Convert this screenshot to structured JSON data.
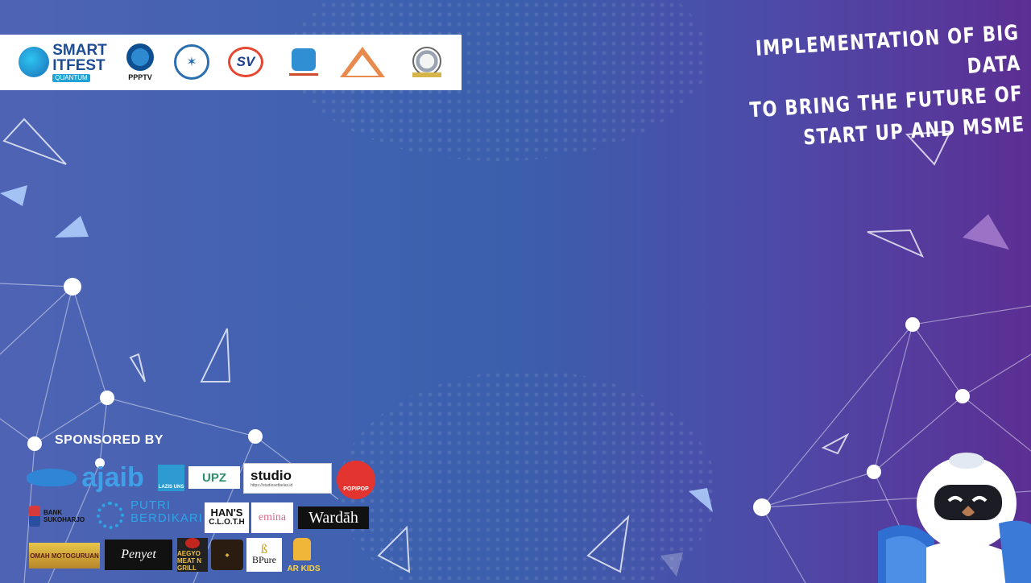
{
  "headline": {
    "line1": "IMPLEMENTATION OF BIG DATA",
    "line2": "TO BRING THE FUTURE OF",
    "line3": "START UP AND MSME"
  },
  "logo_bar": {
    "smart_line1": "SMART",
    "smart_line2": "ITFEST",
    "smart_tag": "QUANTUM",
    "ppptv_label": "PPPTV"
  },
  "sponsored": {
    "heading": "SPONSORED BY",
    "ajaib": "ajaib",
    "lazis": "LAZIS UNS",
    "upz": "UPZ",
    "studio_name": "studio",
    "studio_tag": "https://studiosetbelas.id",
    "popipop": "POPIPOP",
    "bank_line1": "BANK",
    "bank_line2": "SUKOHARJO",
    "putri_line1": "PUTRI",
    "putri_line2": "BERDIKARI",
    "hans_line1": "HAN'S",
    "hans_line2": "C.L.O.T.H",
    "emina": "emina",
    "wardah": "Wardāh",
    "omah": "OMAH MOTOGURUAN",
    "penyet": "Penyet",
    "aegyo": "AEGYO MEAT N GRILL",
    "bpure": "BPure",
    "arkids": "AR KIDS"
  },
  "colors": {
    "gradient_left": "#4f63b4",
    "gradient_mid": "#3b5fac",
    "gradient_right": "#5c2f94",
    "text": "#ffffff"
  },
  "icons": [
    "brain-logo-icon",
    "ppptv-emblem-icon",
    "uns-seal-icon",
    "sv-logo-icon",
    "citi-logo-icon",
    "sitinet-logo-icon",
    "hima-logo-icon",
    "robot-mascot-icon"
  ]
}
